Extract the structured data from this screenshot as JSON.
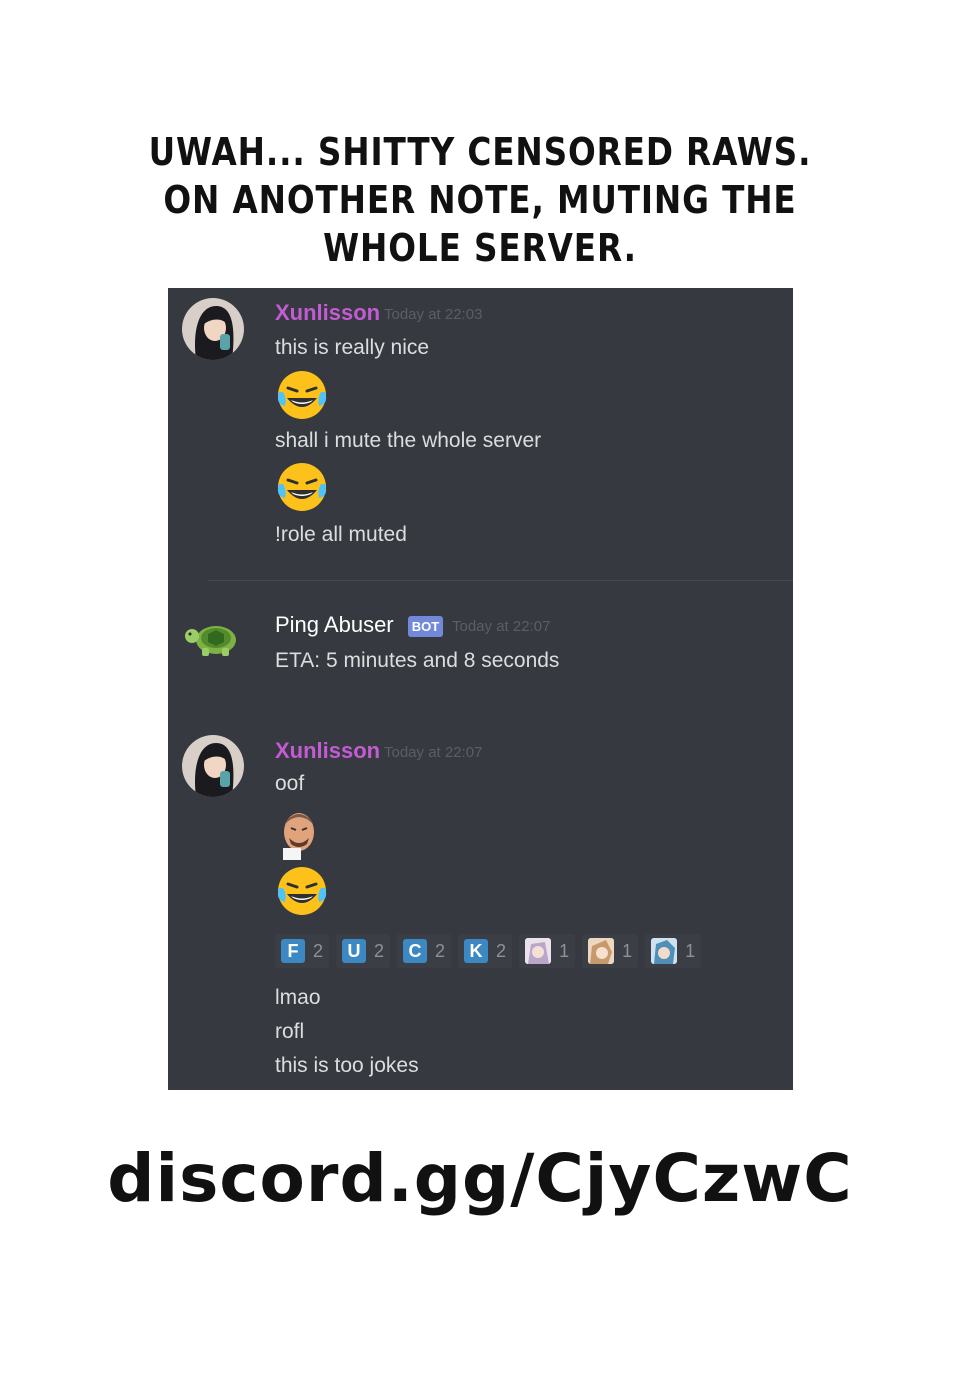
{
  "caption": {
    "line1": "UWAH... SHITTY CENSORED RAWS.",
    "line2": "ON ANOTHER NOTE, MUTING THE",
    "line3": "WHOLE SERVER."
  },
  "messages": {
    "m1": {
      "username": "Xunlisson",
      "timestamp": "Today at 22:03",
      "line1": "this is really nice",
      "line2": "shall i mute the whole server",
      "line3": "!role all muted"
    },
    "m2": {
      "username": "Ping Abuser",
      "badge": "BOT",
      "timestamp": "Today at 22:07",
      "line1": "ETA: 5 minutes and 8 seconds"
    },
    "m3": {
      "username": "Xunlisson",
      "timestamp": "Today at 22:07",
      "line1": "oof",
      "line2": "lmao",
      "line3": "rofl",
      "line4": "this is too jokes"
    }
  },
  "reactions": [
    {
      "icon": "letter-f-icon",
      "letter": "F",
      "count": "2"
    },
    {
      "icon": "letter-u-icon",
      "letter": "U",
      "count": "2"
    },
    {
      "icon": "letter-c-icon",
      "letter": "C",
      "count": "2"
    },
    {
      "icon": "letter-k-icon",
      "letter": "K",
      "count": "2"
    },
    {
      "icon": "anime-emote-icon",
      "count": "1"
    },
    {
      "icon": "anime-emote-icon",
      "count": "1"
    },
    {
      "icon": "anime-emote-icon",
      "count": "1"
    }
  ],
  "invite": {
    "link": "discord.gg/CjyCzwC"
  },
  "colors": {
    "background": "#36393f",
    "username_pink": "#c35bd3",
    "bot_badge": "#7289da",
    "reaction_letter": "#3b88c3"
  }
}
